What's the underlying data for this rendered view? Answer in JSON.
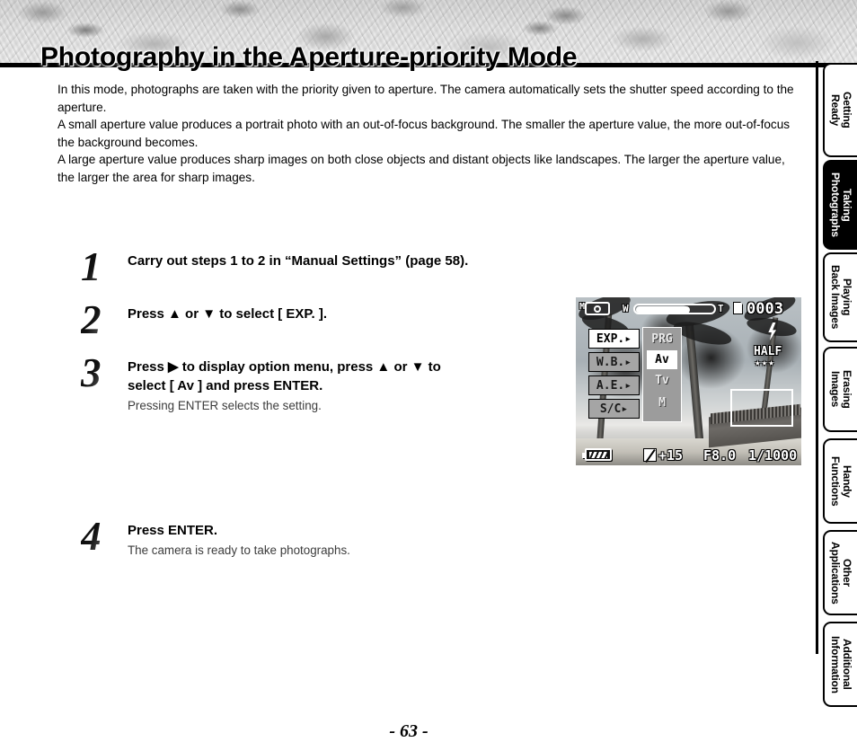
{
  "header": {
    "title": "Photography in the Aperture-priority Mode"
  },
  "intro": {
    "paragraph1": "In this mode, photographs are taken with the priority given to aperture. The camera automatically sets the shutter speed according to the aperture.",
    "paragraph2": "A small aperture value produces a portrait photo with an out-of-focus background. The smaller the aperture value, the more out-of-focus the background becomes.",
    "paragraph3": "A large aperture value produces sharp images on both close objects and distant objects like landscapes. The larger the aperture value, the larger the area for sharp images."
  },
  "steps": [
    {
      "number": "1",
      "title": "Carry out steps 1 to 2 in “Manual Settings” (page 58).",
      "sub": ""
    },
    {
      "number": "2",
      "title": "Press ▲ or ▼ to select [ EXP. ].",
      "sub": ""
    },
    {
      "number": "3",
      "title_line1": "Press ▶ to display option menu, press ▲ or ▼ to",
      "title_line2": "select  [ Av ] and press ENTER.",
      "sub": "Pressing ENTER selects the setting."
    },
    {
      "number": "4",
      "title": "Press ENTER.",
      "sub": "The camera is ready to take photographs."
    }
  ],
  "lcd": {
    "mode_letter": "M",
    "camera_icon": "camera-icon",
    "zoom_wide_label": "W",
    "zoom_tele_label": "T",
    "card_icon": "memory-card-icon",
    "shot_count": "0003",
    "menu_left": [
      {
        "label": "EXP.▸",
        "state": "selected"
      },
      {
        "label": "W.B.▸",
        "state": "dim"
      },
      {
        "label": "A.E.▸",
        "state": "dim"
      },
      {
        "label": "S/C▸",
        "state": "dim"
      }
    ],
    "menu_right": [
      {
        "label": "PRG",
        "state": "normal"
      },
      {
        "label": "Av",
        "state": "selected"
      },
      {
        "label": "Tv",
        "state": "normal"
      },
      {
        "label": "M",
        "state": "normal"
      }
    ],
    "flash_icon": "flash-bolt-icon",
    "half_label": "HALF",
    "stars": "★★★",
    "battery_icon": "battery-icon",
    "exposure_comp_icon": "exposure-compensation-icon",
    "exposure_comp_value": "+15",
    "aperture": "F8.0",
    "shutter_speed": "1/1000"
  },
  "tabs": [
    {
      "label": "Getting\nReady",
      "active": false
    },
    {
      "label": "Taking\nPhotographs",
      "active": true
    },
    {
      "label": "Playing\nBack Images",
      "active": false
    },
    {
      "label": "Erasing\nImages",
      "active": false
    },
    {
      "label": "Handy\nFunctions",
      "active": false
    },
    {
      "label": "Other\nApplications",
      "active": false
    },
    {
      "label": "Additional\nInformation",
      "active": false
    }
  ],
  "footer": {
    "page_number": "- 63 -"
  }
}
